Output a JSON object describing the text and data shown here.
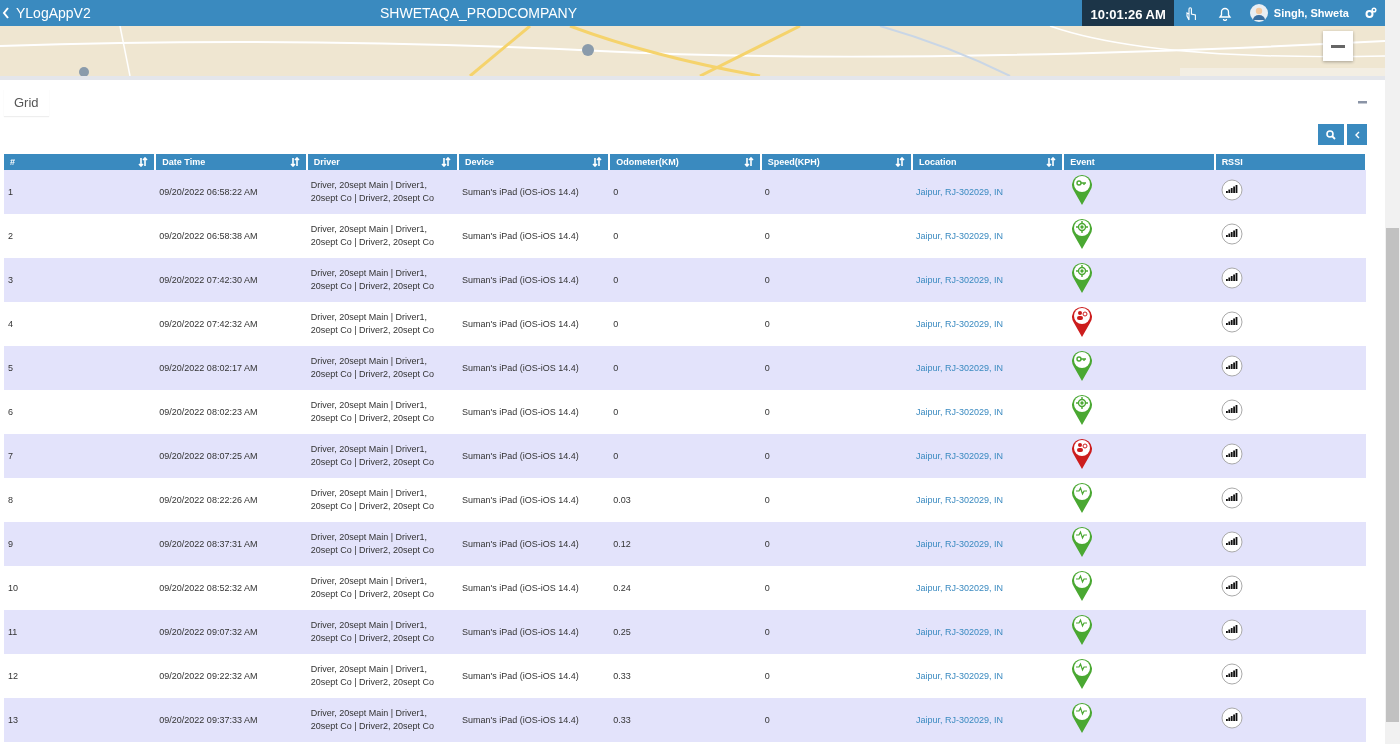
{
  "header": {
    "app_name": "YLogAppV2",
    "company": "SHWETAQA_PRODCOMPANY",
    "clock": "10:01:26 AM",
    "user": "Singh, Shweta"
  },
  "panel": {
    "tab": "Grid"
  },
  "table": {
    "columns": [
      {
        "label": "#",
        "sortable": true
      },
      {
        "label": "Date Time",
        "sortable": true
      },
      {
        "label": "Driver",
        "sortable": true
      },
      {
        "label": "Device",
        "sortable": true
      },
      {
        "label": "Odometer(KM)",
        "sortable": true
      },
      {
        "label": "Speed(KPH)",
        "sortable": true
      },
      {
        "label": "Location",
        "sortable": true
      },
      {
        "label": "Event",
        "sortable": false
      },
      {
        "label": "RSSI",
        "sortable": false
      }
    ],
    "rows": [
      {
        "n": "1",
        "time": "09/20/2022 06:58:22 AM",
        "driver": "Driver, 20sept Main | Driver1, 20sept Co | Driver2, 20sept Co",
        "device": "Suman's iPad (iOS-iOS 14.4)",
        "odometer": "0",
        "speed": "0",
        "location": "Jaipur, RJ-302029, IN",
        "event": {
          "kind": "key"
        }
      },
      {
        "n": "2",
        "time": "09/20/2022 06:58:38 AM",
        "driver": "Driver, 20sept Main | Driver1, 20sept Co | Driver2, 20sept Co",
        "device": "Suman's iPad (iOS-iOS 14.4)",
        "odometer": "0",
        "speed": "0",
        "location": "Jaipur, RJ-302029, IN",
        "event": {
          "kind": "target"
        }
      },
      {
        "n": "3",
        "time": "09/20/2022 07:42:30 AM",
        "driver": "Driver, 20sept Main | Driver1, 20sept Co | Driver2, 20sept Co",
        "device": "Suman's iPad (iOS-iOS 14.4)",
        "odometer": "0",
        "speed": "0",
        "location": "Jaipur, RJ-302029, IN",
        "event": {
          "kind": "target"
        }
      },
      {
        "n": "4",
        "time": "09/20/2022 07:42:32 AM",
        "driver": "Driver, 20sept Main | Driver1, 20sept Co | Driver2, 20sept Co",
        "device": "Suman's iPad (iOS-iOS 14.4)",
        "odometer": "0",
        "speed": "0",
        "location": "Jaipur, RJ-302029, IN",
        "event": {
          "kind": "driver"
        }
      },
      {
        "n": "5",
        "time": "09/20/2022 08:02:17 AM",
        "driver": "Driver, 20sept Main | Driver1, 20sept Co | Driver2, 20sept Co",
        "device": "Suman's iPad (iOS-iOS 14.4)",
        "odometer": "0",
        "speed": "0",
        "location": "Jaipur, RJ-302029, IN",
        "event": {
          "kind": "key"
        }
      },
      {
        "n": "6",
        "time": "09/20/2022 08:02:23 AM",
        "driver": "Driver, 20sept Main | Driver1, 20sept Co | Driver2, 20sept Co",
        "device": "Suman's iPad (iOS-iOS 14.4)",
        "odometer": "0",
        "speed": "0",
        "location": "Jaipur, RJ-302029, IN",
        "event": {
          "kind": "target"
        }
      },
      {
        "n": "7",
        "time": "09/20/2022 08:07:25 AM",
        "driver": "Driver, 20sept Main | Driver1, 20sept Co | Driver2, 20sept Co",
        "device": "Suman's iPad (iOS-iOS 14.4)",
        "odometer": "0",
        "speed": "0",
        "location": "Jaipur, RJ-302029, IN",
        "event": {
          "kind": "driver"
        }
      },
      {
        "n": "8",
        "time": "09/20/2022 08:22:26 AM",
        "driver": "Driver, 20sept Main | Driver1, 20sept Co | Driver2, 20sept Co",
        "device": "Suman's iPad (iOS-iOS 14.4)",
        "odometer": "0.03",
        "speed": "0",
        "location": "Jaipur, RJ-302029, IN",
        "event": {
          "kind": "pulse"
        }
      },
      {
        "n": "9",
        "time": "09/20/2022 08:37:31 AM",
        "driver": "Driver, 20sept Main | Driver1, 20sept Co | Driver2, 20sept Co",
        "device": "Suman's iPad (iOS-iOS 14.4)",
        "odometer": "0.12",
        "speed": "0",
        "location": "Jaipur, RJ-302029, IN",
        "event": {
          "kind": "pulse"
        }
      },
      {
        "n": "10",
        "time": "09/20/2022 08:52:32 AM",
        "driver": "Driver, 20sept Main | Driver1, 20sept Co | Driver2, 20sept Co",
        "device": "Suman's iPad (iOS-iOS 14.4)",
        "odometer": "0.24",
        "speed": "0",
        "location": "Jaipur, RJ-302029, IN",
        "event": {
          "kind": "pulse"
        }
      },
      {
        "n": "11",
        "time": "09/20/2022 09:07:32 AM",
        "driver": "Driver, 20sept Main | Driver1, 20sept Co | Driver2, 20sept Co",
        "device": "Suman's iPad (iOS-iOS 14.4)",
        "odometer": "0.25",
        "speed": "0",
        "location": "Jaipur, RJ-302029, IN",
        "event": {
          "kind": "pulse"
        }
      },
      {
        "n": "12",
        "time": "09/20/2022 09:22:32 AM",
        "driver": "Driver, 20sept Main | Driver1, 20sept Co | Driver2, 20sept Co",
        "device": "Suman's iPad (iOS-iOS 14.4)",
        "odometer": "0.33",
        "speed": "0",
        "location": "Jaipur, RJ-302029, IN",
        "event": {
          "kind": "pulse"
        }
      },
      {
        "n": "13",
        "time": "09/20/2022 09:37:33 AM",
        "driver": "Driver, 20sept Main | Driver1, 20sept Co | Driver2, 20sept Co",
        "device": "Suman's iPad (iOS-iOS 14.4)",
        "odometer": "0.33",
        "speed": "0",
        "location": "Jaipur, RJ-302029, IN",
        "event": {
          "kind": "pulse"
        }
      }
    ]
  }
}
